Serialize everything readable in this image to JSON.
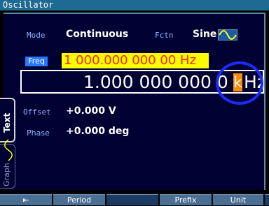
{
  "window": {
    "title": "Oscillator"
  },
  "params": {
    "mode": {
      "label": "Mode",
      "value": "Continuous"
    },
    "function": {
      "label": "Fctn",
      "value": "Sine",
      "icon": "sine-wave-icon"
    },
    "frequency": {
      "label": "Freq",
      "value": "1 000.000 000 00 Hz",
      "entry": "1.000 000 000 0",
      "cursor_char": "k",
      "entry_unit": "Hz"
    },
    "offset": {
      "label": "Offset",
      "value": "+0.000 V"
    },
    "phase": {
      "label": "Phase",
      "value": "+0.000 deg"
    }
  },
  "side_tabs": {
    "text": "Text",
    "graph": "Graph"
  },
  "softkeys": [
    "⇤",
    "Period",
    "",
    "Prefix",
    "Unit"
  ],
  "colors": {
    "title_bar": "#1e6a92",
    "panel_bg": "#000033",
    "freq_highlight_bg": "#ffff00",
    "freq_highlight_fg": "#ff2200",
    "cursor_bg": "#ff8a00",
    "label_fg": "#8fb8ff",
    "softkey_bg": "#4b6e93",
    "ring": "#1a2cff"
  }
}
